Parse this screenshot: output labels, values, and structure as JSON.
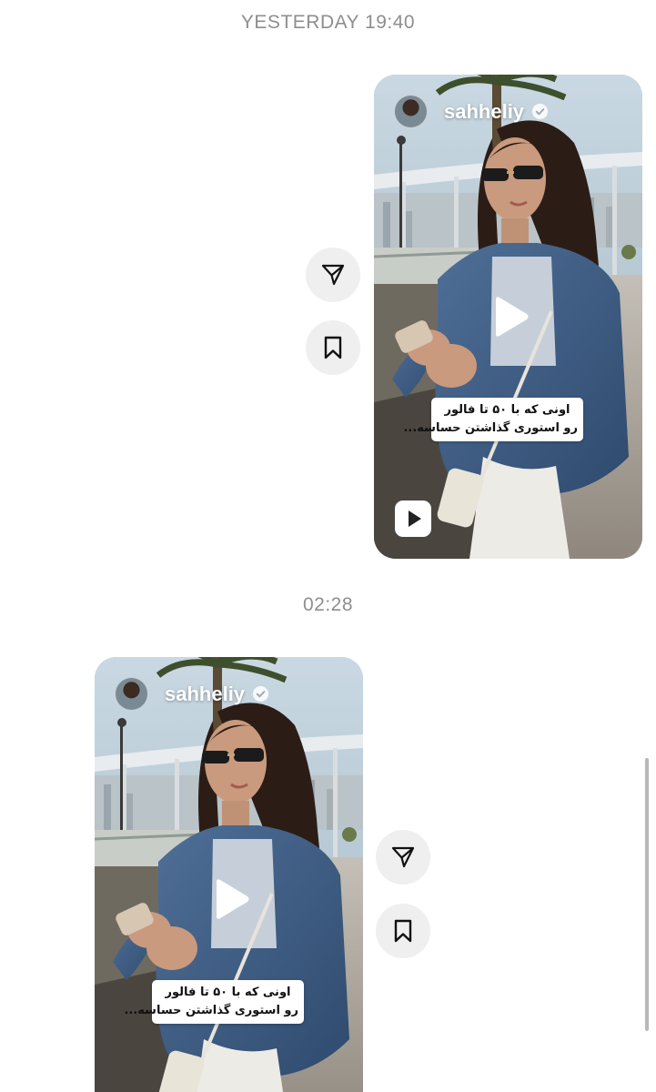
{
  "thread": {
    "timestamp_1": "YESTERDAY 19:40",
    "timestamp_2": "02:28"
  },
  "messages": [
    {
      "type": "shared-reel",
      "username": "sahheliy",
      "verified": true,
      "caption_line_1": "اونی که با ۵۰ تا فالور",
      "caption_line_2": "رو استوری گذاشتن حساسه..."
    },
    {
      "type": "shared-reel",
      "username": "sahheliy",
      "verified": true,
      "caption_line_1": "اونی که با ۵۰ تا فالور",
      "caption_line_2": "رو استوری گذاشتن حساسه..."
    }
  ],
  "icons": {
    "share": "paper-plane-icon",
    "save": "bookmark-icon",
    "play": "play-icon",
    "reel": "reel-icon",
    "verified": "verified-badge-icon"
  },
  "colors": {
    "background": "#ffffff",
    "timestamp_text": "#8e8e8e",
    "action_button_bg": "#efefef"
  }
}
